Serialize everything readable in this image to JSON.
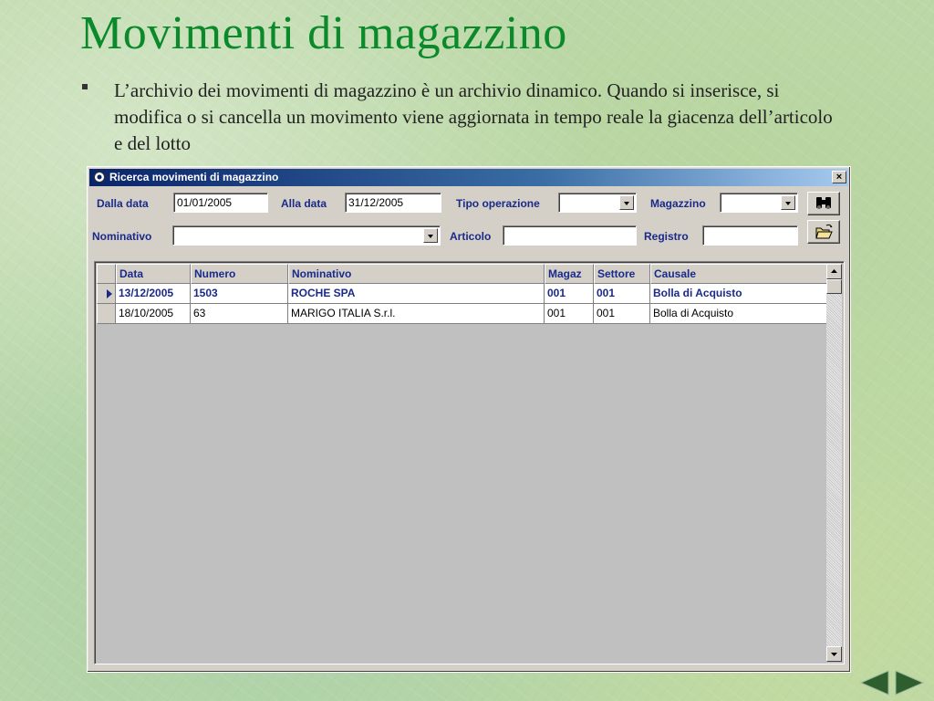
{
  "slide": {
    "title": "Movimenti di magazzino",
    "bullet": "L’archivio dei movimenti di magazzino è un archivio dinamico. Quando si inserisce, si modifica o si cancella un  movimento viene aggiornata in tempo reale la giacenza dell’articolo e del lotto"
  },
  "window": {
    "title": "Ricerca movimenti di magazzino",
    "close": "×"
  },
  "filters": {
    "dalla_data_label": "Dalla data",
    "dalla_data_value": "01/01/2005",
    "alla_data_label": "Alla data",
    "alla_data_value": "31/12/2005",
    "tipo_operazione_label": "Tipo operazione",
    "tipo_operazione_value": "",
    "magazzino_label": "Magazzino",
    "magazzino_value": "",
    "nominativo_label": "Nominativo",
    "nominativo_value": "",
    "articolo_label": "Articolo",
    "articolo_value": "",
    "registro_label": "Registro",
    "registro_value": ""
  },
  "icons": {
    "search": "binoculars-icon",
    "open": "open-folder-icon",
    "prev": "triangle-left-icon",
    "next": "triangle-right-icon"
  },
  "grid": {
    "columns": [
      "Data",
      "Numero",
      "Nominativo",
      "Magaz",
      "Settore",
      "Causale"
    ],
    "rows": [
      {
        "data": "13/12/2005",
        "numero": "1503",
        "nominativo": "ROCHE SPA",
        "magaz": "001",
        "settore": "001",
        "causale": "Bolla di Acquisto",
        "selected": true
      },
      {
        "data": "18/10/2005",
        "numero": "63",
        "nominativo": "MARIGO ITALIA S.r.l.",
        "magaz": "001",
        "settore": "001",
        "causale": "Bolla di Acquisto",
        "selected": false
      }
    ]
  },
  "colors": {
    "title_green": "#0a8a2a",
    "label_blue": "#1a2a8a",
    "titlebar_start": "#0a246a"
  }
}
